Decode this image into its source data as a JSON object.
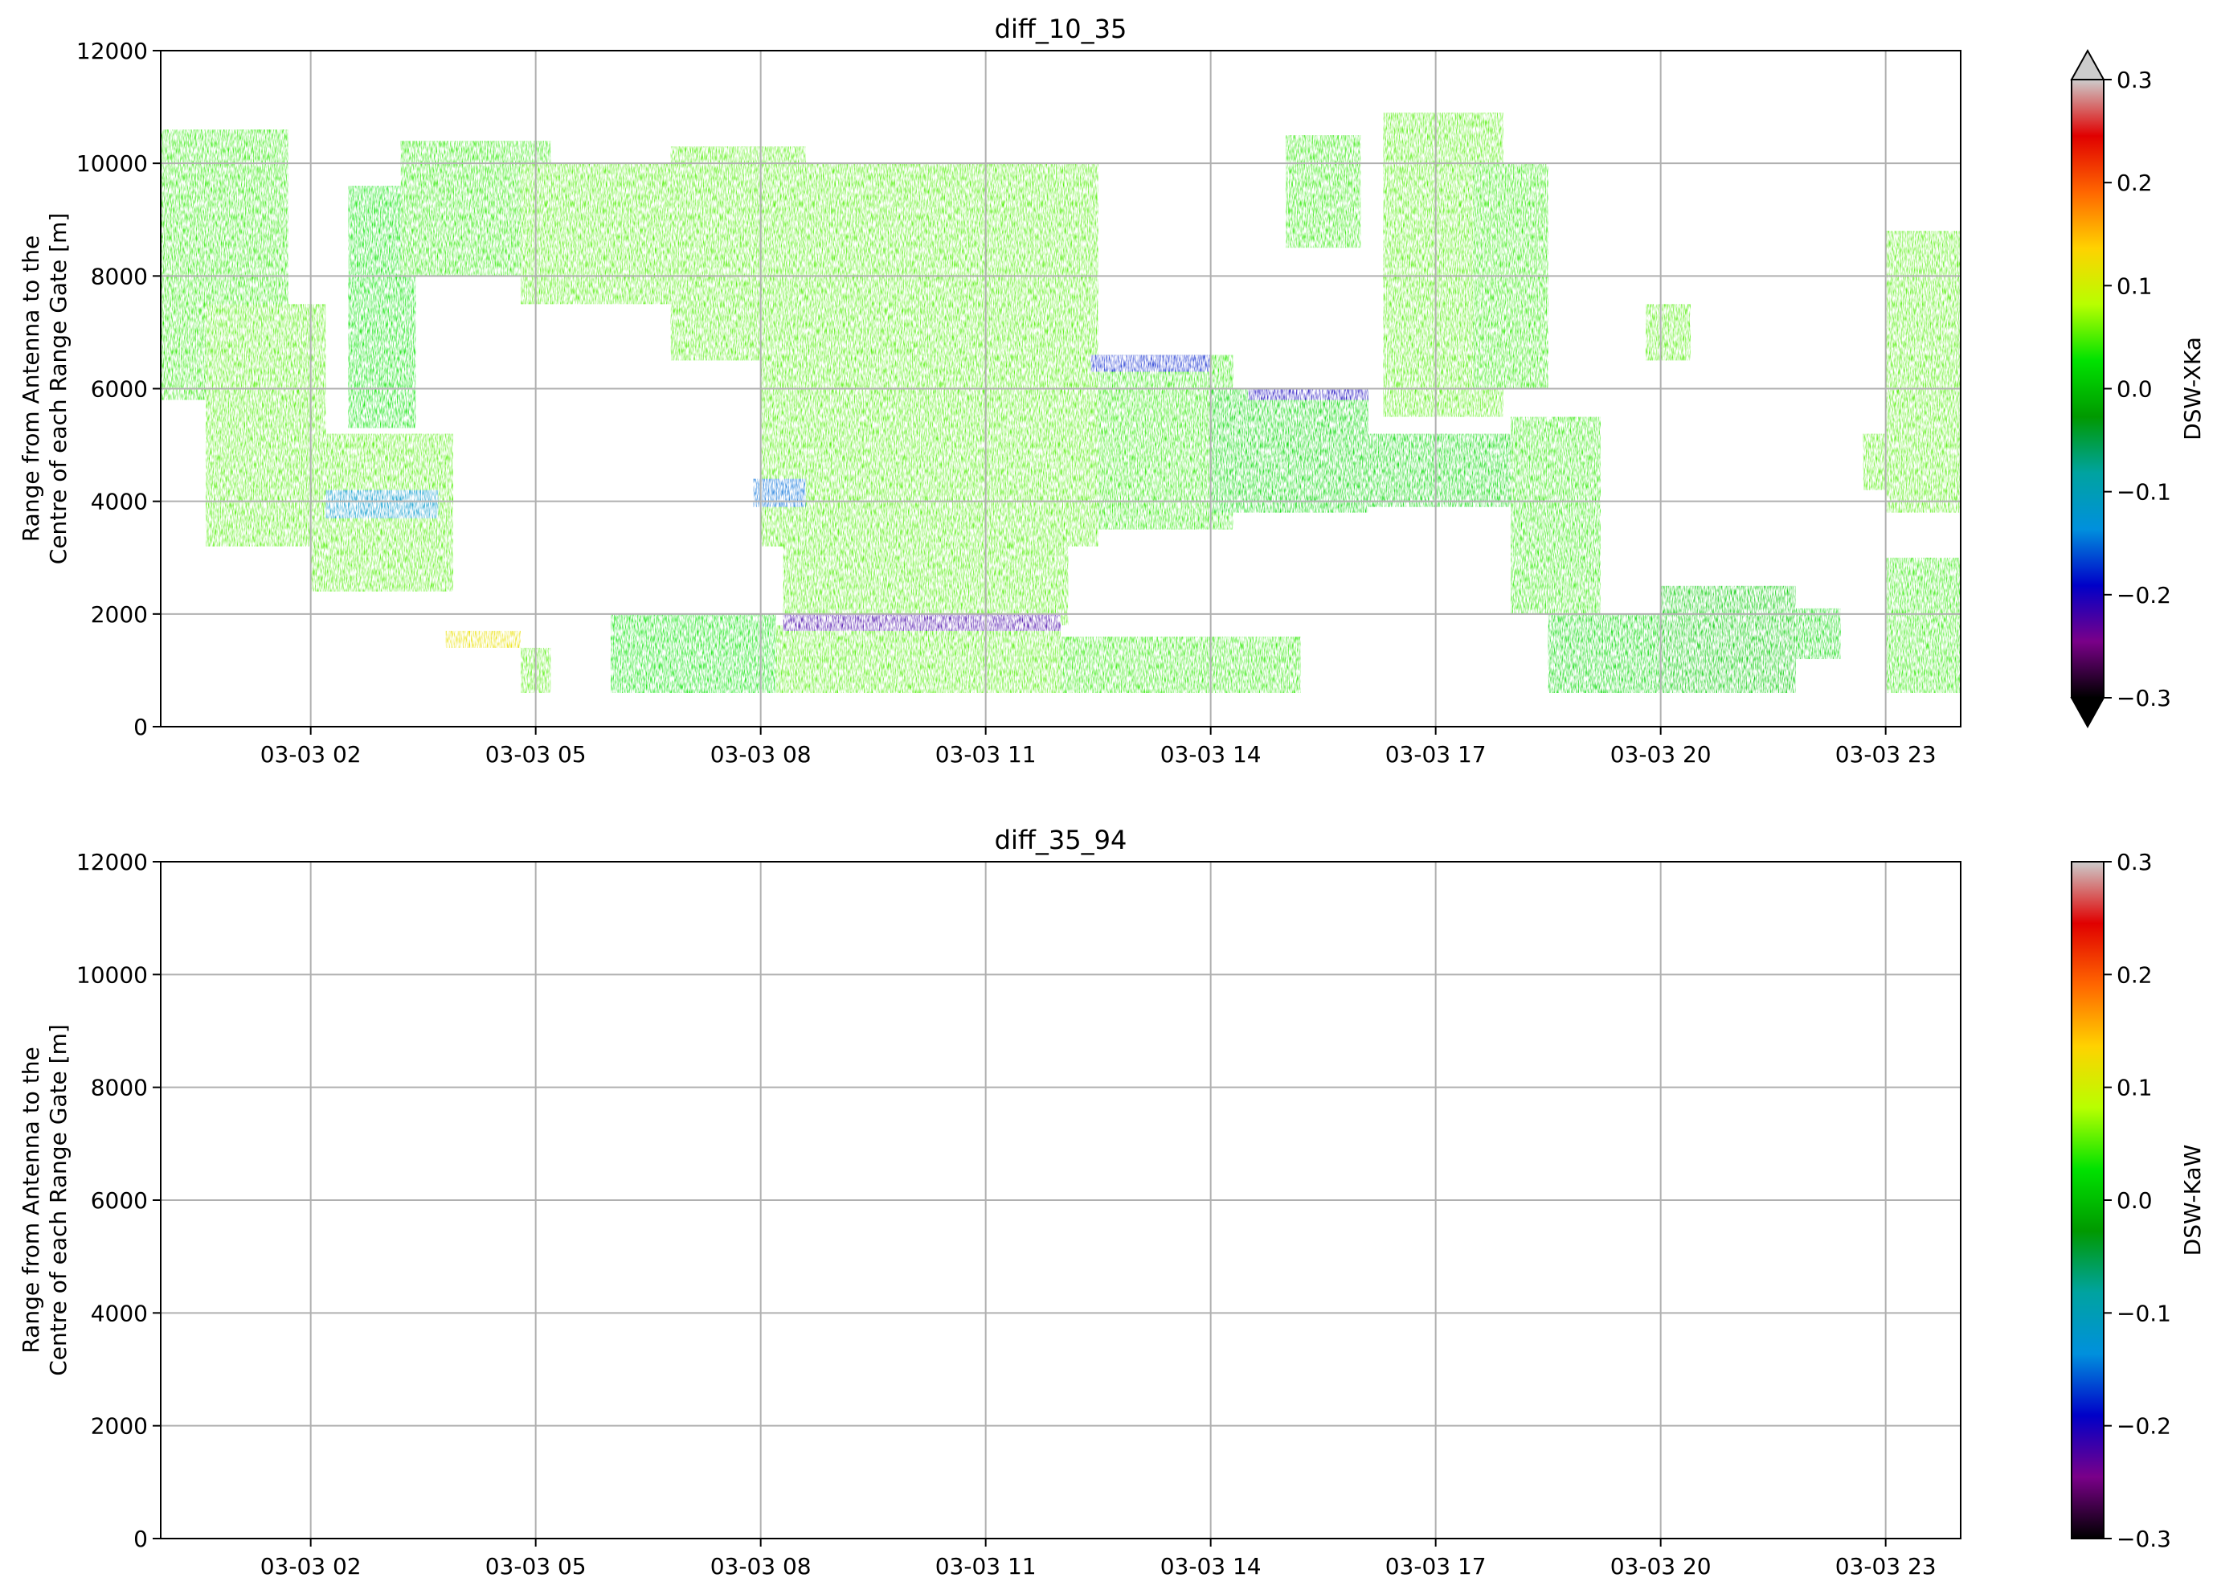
{
  "chart_data": [
    {
      "type": "heatmap",
      "title": "diff_10_35",
      "xlabel": "",
      "ylabel_lines": [
        "Range from Antenna to the",
        "Centre of each Range Gate [m]"
      ],
      "x_tick_labels": [
        "03-03 02",
        "03-03 05",
        "03-03 08",
        "03-03 11",
        "03-03 14",
        "03-03 17",
        "03-03 20",
        "03-03 23"
      ],
      "x_tick_hours": [
        2,
        5,
        8,
        11,
        14,
        17,
        20,
        23
      ],
      "xlim_hours": [
        0,
        24
      ],
      "y_ticks": [
        0,
        2000,
        4000,
        6000,
        8000,
        10000,
        12000
      ],
      "y_tick_labels": [
        "0",
        "2000",
        "4000",
        "6000",
        "8000",
        "10000",
        "12000"
      ],
      "ylim": [
        0,
        12000
      ],
      "grid": true,
      "colorbar": {
        "label": "DSW-XKa",
        "ticks": [
          0.3,
          0.2,
          0.1,
          0.0,
          -0.1,
          -0.2,
          -0.3
        ],
        "tick_labels": [
          "0.3",
          "0.2",
          "0.1",
          "0.0",
          "−0.1",
          "−0.2",
          "−0.3"
        ],
        "range": [
          -0.3,
          0.3
        ],
        "extend": "both"
      },
      "has_data": true,
      "regions": [
        {
          "t0": 0.0,
          "t1": 1.7,
          "r0": 5800,
          "r1": 10600,
          "v": 0.04
        },
        {
          "t0": 0.6,
          "t1": 2.2,
          "r0": 3200,
          "r1": 7500,
          "v": 0.05
        },
        {
          "t0": 2.0,
          "t1": 3.9,
          "r0": 2400,
          "r1": 5200,
          "v": 0.05
        },
        {
          "t0": 2.2,
          "t1": 3.7,
          "r0": 3700,
          "r1": 4200,
          "v": -0.12
        },
        {
          "t0": 2.5,
          "t1": 3.4,
          "r0": 5300,
          "r1": 9600,
          "v": 0.03
        },
        {
          "t0": 3.2,
          "t1": 5.2,
          "r0": 8000,
          "r1": 10400,
          "v": 0.04
        },
        {
          "t0": 4.8,
          "t1": 7.4,
          "r0": 7500,
          "r1": 10000,
          "v": 0.05
        },
        {
          "t0": 6.8,
          "t1": 8.6,
          "r0": 6500,
          "r1": 10300,
          "v": 0.05
        },
        {
          "t0": 8.0,
          "t1": 12.5,
          "r0": 3200,
          "r1": 10000,
          "v": 0.05
        },
        {
          "t0": 8.3,
          "t1": 12.1,
          "r0": 1800,
          "r1": 4400,
          "v": 0.05
        },
        {
          "t0": 7.9,
          "t1": 8.6,
          "r0": 3900,
          "r1": 4400,
          "v": -0.15
        },
        {
          "t0": 12.5,
          "t1": 14.3,
          "r0": 3500,
          "r1": 6600,
          "v": 0.04
        },
        {
          "t0": 12.4,
          "t1": 14.0,
          "r0": 6300,
          "r1": 6600,
          "v": -0.18
        },
        {
          "t0": 14.0,
          "t1": 16.1,
          "r0": 3800,
          "r1": 6000,
          "v": 0.02
        },
        {
          "t0": 14.5,
          "t1": 16.1,
          "r0": 5800,
          "r1": 6000,
          "v": -0.2
        },
        {
          "t0": 16.0,
          "t1": 18.0,
          "r0": 3900,
          "r1": 5200,
          "v": 0.02
        },
        {
          "t0": 15.0,
          "t1": 16.0,
          "r0": 8500,
          "r1": 10500,
          "v": 0.04
        },
        {
          "t0": 16.3,
          "t1": 17.9,
          "r0": 5500,
          "r1": 10900,
          "v": 0.05
        },
        {
          "t0": 17.5,
          "t1": 18.5,
          "r0": 6000,
          "r1": 10000,
          "v": 0.04
        },
        {
          "t0": 18.0,
          "t1": 19.2,
          "r0": 2000,
          "r1": 5500,
          "v": 0.04
        },
        {
          "t0": 19.8,
          "t1": 20.4,
          "r0": 6500,
          "r1": 7500,
          "v": 0.05
        },
        {
          "t0": 23.0,
          "t1": 24.0,
          "r0": 3800,
          "r1": 8800,
          "v": 0.05
        },
        {
          "t0": 22.7,
          "t1": 23.0,
          "r0": 4200,
          "r1": 5200,
          "v": 0.05
        },
        {
          "t0": 6.0,
          "t1": 8.2,
          "r0": 600,
          "r1": 2000,
          "v": 0.03
        },
        {
          "t0": 8.2,
          "t1": 12.0,
          "r0": 600,
          "r1": 1800,
          "v": 0.05
        },
        {
          "t0": 8.3,
          "t1": 12.0,
          "r0": 1700,
          "r1": 2000,
          "v": -0.22
        },
        {
          "t0": 12.0,
          "t1": 15.2,
          "r0": 600,
          "r1": 1600,
          "v": 0.04
        },
        {
          "t0": 18.5,
          "t1": 20.0,
          "r0": 600,
          "r1": 2000,
          "v": 0.02
        },
        {
          "t0": 20.0,
          "t1": 21.8,
          "r0": 600,
          "r1": 2500,
          "v": 0.01
        },
        {
          "t0": 21.8,
          "t1": 22.4,
          "r0": 1200,
          "r1": 2100,
          "v": 0.02
        },
        {
          "t0": 23.0,
          "t1": 24.0,
          "r0": 600,
          "r1": 3000,
          "v": 0.04
        },
        {
          "t0": 3.8,
          "t1": 4.8,
          "r0": 1400,
          "r1": 1700,
          "v": 0.12
        },
        {
          "t0": 4.8,
          "t1": 5.2,
          "r0": 600,
          "r1": 1400,
          "v": 0.05
        }
      ]
    },
    {
      "type": "heatmap",
      "title": "diff_35_94",
      "xlabel": "",
      "ylabel_lines": [
        "Range from Antenna to the",
        "Centre of each Range Gate [m]"
      ],
      "x_tick_labels": [
        "03-03 02",
        "03-03 05",
        "03-03 08",
        "03-03 11",
        "03-03 14",
        "03-03 17",
        "03-03 20",
        "03-03 23"
      ],
      "x_tick_hours": [
        2,
        5,
        8,
        11,
        14,
        17,
        20,
        23
      ],
      "xlim_hours": [
        0,
        24
      ],
      "y_ticks": [
        0,
        2000,
        4000,
        6000,
        8000,
        10000,
        12000
      ],
      "y_tick_labels": [
        "0",
        "2000",
        "4000",
        "6000",
        "8000",
        "10000",
        "12000"
      ],
      "ylim": [
        0,
        12000
      ],
      "grid": true,
      "colorbar": {
        "label": "DSW-KaW",
        "ticks": [
          0.3,
          0.2,
          0.1,
          0.0,
          -0.1,
          -0.2,
          -0.3
        ],
        "tick_labels": [
          "0.3",
          "0.2",
          "0.1",
          "0.0",
          "−0.1",
          "−0.2",
          "−0.3"
        ],
        "range": [
          -0.3,
          0.3
        ],
        "extend": "neither"
      },
      "has_data": false,
      "regions": []
    }
  ],
  "colors": {
    "gridline": "#b0b0b0",
    "colormap_stops": [
      "#000000",
      "#7a0089",
      "#0000c8",
      "#0090dd",
      "#00a3a0",
      "#009900",
      "#00e200",
      "#b8ff00",
      "#ffd200",
      "#ff6600",
      "#e00000",
      "#cccccc"
    ]
  }
}
